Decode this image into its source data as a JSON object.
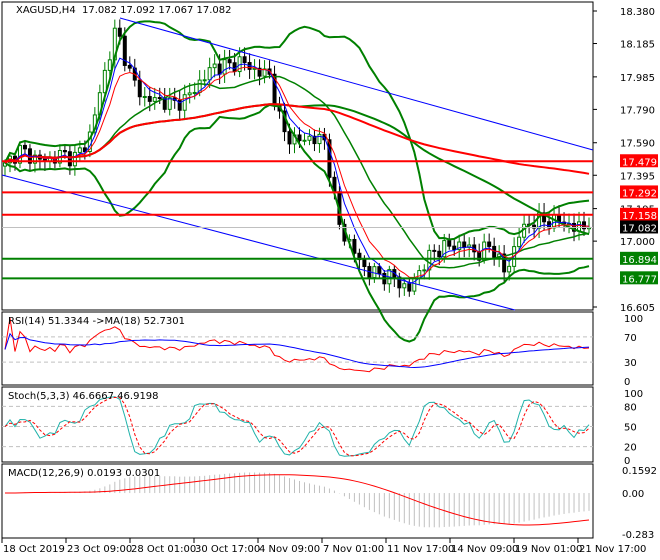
{
  "header": {
    "symbol": "XAGUSD,H4",
    "ohlc": "17.082 17.092 17.067 17.082"
  },
  "colors": {
    "bull": "#008000",
    "bear": "#000000",
    "bands": "#008000",
    "ma_red": "#ff0000",
    "ma_blue": "#0000ff",
    "rsi": "#ff0000",
    "rsi_ma": "#0000ff",
    "stoch_main": "#20b2aa",
    "stoch_signal": "#ff0000",
    "macd_hist": "#c0c0c0",
    "macd_signal": "#ff0000"
  },
  "chart_data": [
    {
      "type": "candlestick",
      "title": "XAGUSD,H4",
      "ylim": [
        16.605,
        18.38
      ],
      "yticks": [
        "18.380",
        "18.185",
        "17.985",
        "17.790",
        "17.590",
        "17.395",
        "17.195",
        "17.000",
        "16.605"
      ],
      "xticks": [
        "18 Oct 2019",
        "23 Oct 09:00",
        "28 Oct 01:00",
        "30 Oct 17:00",
        "4 Nov 09:00",
        "7 Nov 01:00",
        "11 Nov 17:00",
        "14 Nov 09:00",
        "19 Nov 01:00",
        "21 Nov 17:00"
      ],
      "closes_approx": [
        17.45,
        17.55,
        17.5,
        17.48,
        17.52,
        17.5,
        17.6,
        17.95,
        18.28,
        18.0,
        17.85,
        17.85,
        17.82,
        17.85,
        17.95,
        18.05,
        18.05,
        18.08,
        18.02,
        18.0,
        17.65,
        17.6,
        17.62,
        17.6,
        17.1,
        16.95,
        16.82,
        16.8,
        16.78,
        16.7,
        16.85,
        16.95,
        16.97,
        16.98,
        16.92,
        16.98,
        16.8,
        17.05,
        17.12,
        17.12,
        17.12,
        17.08,
        17.082
      ],
      "levels": [
        {
          "value": 17.479,
          "label": "17.479",
          "color": "#ff0000"
        },
        {
          "value": 17.292,
          "label": "17.292",
          "color": "#ff0000"
        },
        {
          "value": 17.158,
          "label": "17.158",
          "color": "#ff0000"
        },
        {
          "value": 17.082,
          "label": "17.082",
          "color": "#000000"
        },
        {
          "value": 16.894,
          "label": "16.894",
          "color": "#008000"
        },
        {
          "value": 16.777,
          "label": "16.777",
          "color": "#008000"
        }
      ]
    },
    {
      "type": "line",
      "title": "RSI(14) 51.3344  ->MA(18) 52.7301",
      "ylim": [
        0,
        100
      ],
      "yticks": [
        "100",
        "70",
        "30",
        "0"
      ]
    },
    {
      "type": "line",
      "title": "Stoch(5,3,3) 46.6667 46.9198",
      "ylim": [
        0,
        100
      ],
      "yticks": [
        "100",
        "80",
        "50",
        "20",
        "0"
      ]
    },
    {
      "type": "bar",
      "title": "MACD(12,26,9) 0.0193 0.0301",
      "ylim": [
        -0.283,
        0.1592
      ],
      "yticks": [
        "0.1592",
        "0.00",
        "-0.283"
      ]
    }
  ]
}
